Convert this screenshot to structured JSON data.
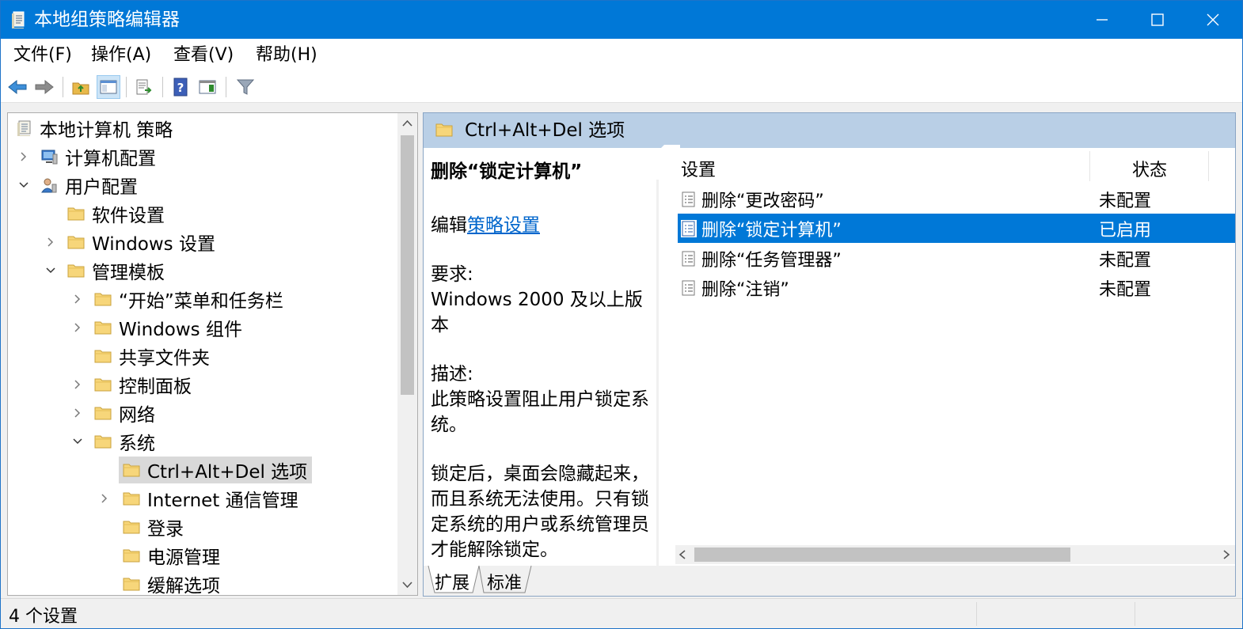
{
  "window": {
    "title": "本地组策略编辑器"
  },
  "menu": [
    "文件(F)",
    "操作(A)",
    "查看(V)",
    "帮助(H)"
  ],
  "tree": {
    "root": "本地计算机 策略",
    "computer": "计算机配置",
    "user": "用户配置",
    "software": "软件设置",
    "windows_settings": "Windows 设置",
    "admin_templates": "管理模板",
    "start_menu": "“开始”菜单和任务栏",
    "windows_components": "Windows 组件",
    "shared_folders": "共享文件夹",
    "control_panel": "控制面板",
    "network": "网络",
    "system": "系统",
    "ctrl_alt_del": "Ctrl+Alt+Del 选项",
    "internet_comm": "Internet 通信管理",
    "logon": "登录",
    "power": "电源管理",
    "mitigation": "缓解选项"
  },
  "details": {
    "header": "Ctrl+Alt+Del 选项",
    "setting_title": "删除“锁定计算机”",
    "edit_prefix": "编辑",
    "edit_link": "策略设置",
    "requirement_label": "要求:",
    "requirement": "Windows 2000 及以上版本",
    "description_label": "描述:",
    "description": "此策略设置阻止用户锁定系统。",
    "description_more": "锁定后，桌面会隐藏起来，而且系统无法使用。只有锁定系统的用户或系统管理员才能解除锁定。"
  },
  "list": {
    "col_setting": "设置",
    "col_state": "状态",
    "rows": [
      {
        "name": "删除“更改密码”",
        "state": "未配置"
      },
      {
        "name": "删除“锁定计算机”",
        "state": "已启用"
      },
      {
        "name": "删除“任务管理器”",
        "state": "未配置"
      },
      {
        "name": "删除“注销”",
        "state": "未配置"
      }
    ]
  },
  "tabs": [
    "扩展",
    "标准"
  ],
  "status": {
    "text": "4 个设置"
  },
  "colors": {
    "titlebar": "#0078d7",
    "selection": "#0078d7",
    "pane_header": "#b9cfe6"
  }
}
